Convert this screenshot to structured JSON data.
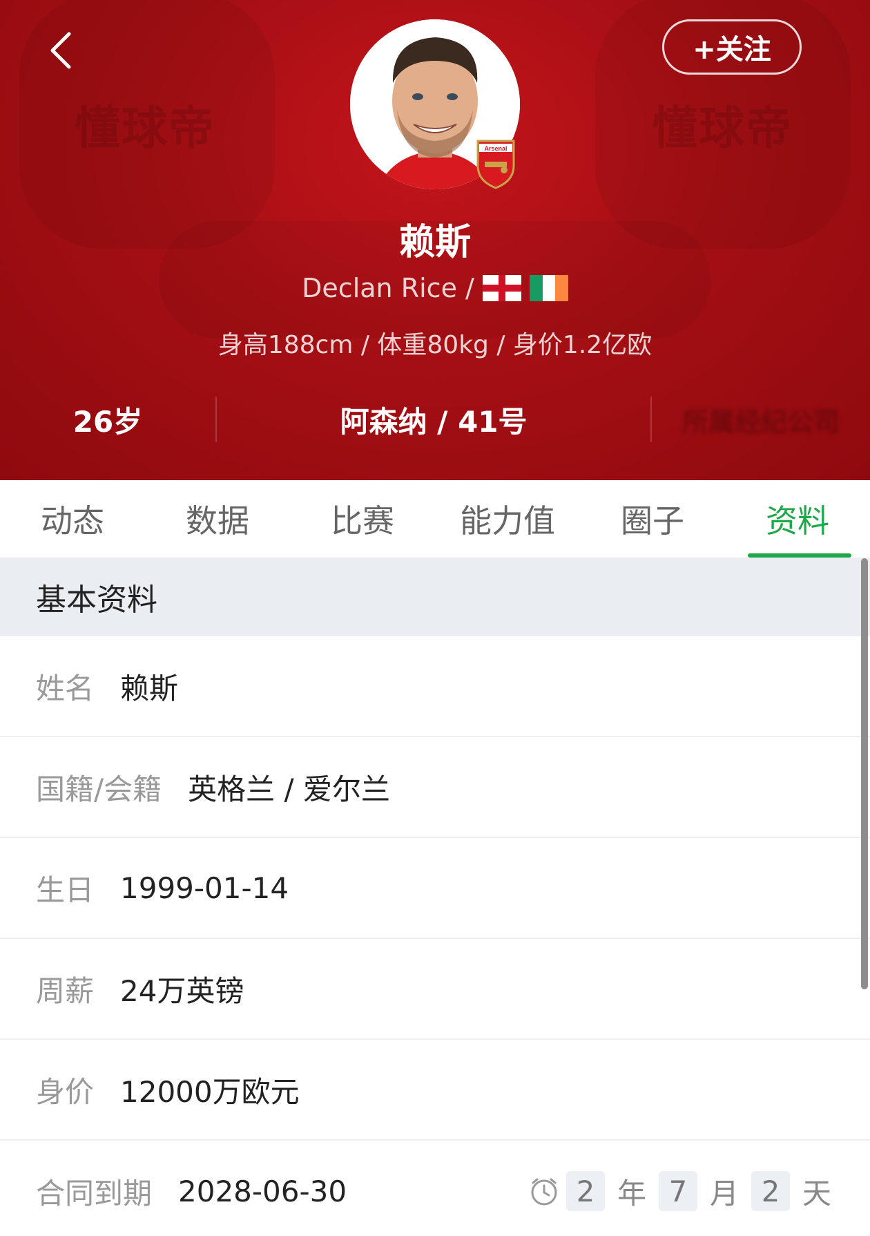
{
  "header": {
    "follow_label": "+关注",
    "watermark_text": "懂球帝",
    "player_name_cn": "赖斯",
    "player_name_en": "Declan Rice /",
    "stats_line": "身高188cm / 体重80kg / 身价1.2亿欧",
    "club_badge_text": "Arsenal",
    "info_bar": {
      "age": "26岁",
      "team": "阿森纳 / 41号",
      "blurred": "所属经纪公司"
    },
    "colors": {
      "primary": "#9b0c10",
      "accent": "#1fa84a"
    },
    "flags": [
      "england-flag",
      "ireland-flag"
    ]
  },
  "tabs": [
    {
      "label": "动态"
    },
    {
      "label": "数据"
    },
    {
      "label": "比赛"
    },
    {
      "label": "能力值"
    },
    {
      "label": "圈子"
    },
    {
      "label": "资料",
      "active": true
    }
  ],
  "section": {
    "title": "基本资料"
  },
  "rows": [
    {
      "label": "姓名",
      "value": "赖斯"
    },
    {
      "label": "国籍/会籍",
      "value": "英格兰 / 爱尔兰"
    },
    {
      "label": "生日",
      "value": "1999-01-14"
    },
    {
      "label": "周薪",
      "value": "24万英镑"
    },
    {
      "label": "身价",
      "value": "12000万欧元"
    },
    {
      "label": "合同到期",
      "value": "2028-06-30"
    }
  ],
  "countdown": {
    "years": "2",
    "year_unit": "年",
    "months": "7",
    "month_unit": "月",
    "days": "2",
    "day_unit": "天"
  }
}
